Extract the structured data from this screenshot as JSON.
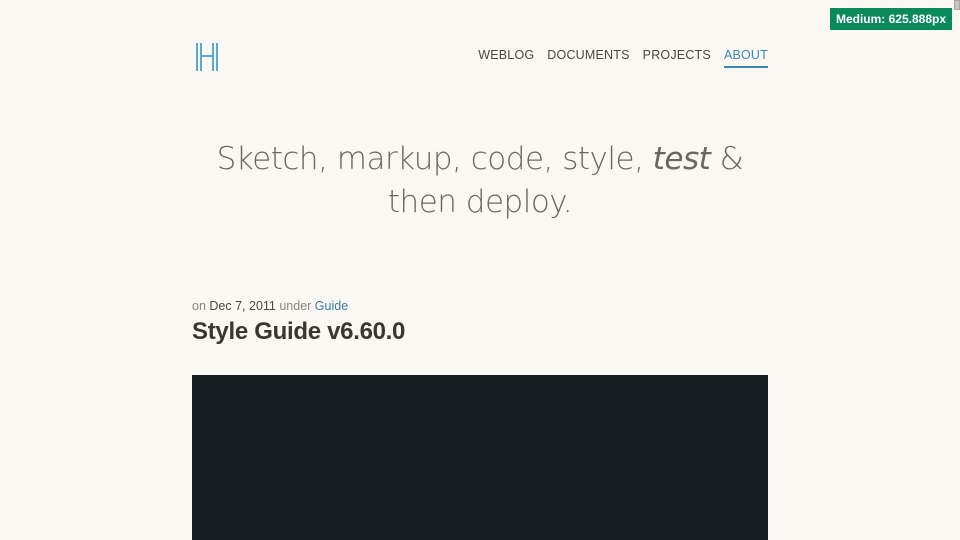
{
  "badge": {
    "text": "Medium: 625.888px"
  },
  "header": {
    "logo_icon": "h-logo-icon",
    "nav": [
      {
        "label": "WEBLOG",
        "active": false
      },
      {
        "label": "DOCUMENTS",
        "active": false
      },
      {
        "label": "PROJECTS",
        "active": false
      },
      {
        "label": "ABOUT",
        "active": true
      }
    ]
  },
  "hero_text": {
    "line1_prefix": "Sketch, markup, code, style, ",
    "line1_italic": "test",
    "line1_suffix": " &",
    "line2": "then deploy."
  },
  "post": {
    "meta_on": "on ",
    "date": "Dec 7, 2011",
    "meta_under": " under ",
    "category": "Guide",
    "title": "Style Guide v6.60.0"
  },
  "colors": {
    "background": "#faf8f2",
    "accent": "#3a89b4",
    "badge": "#0a8a5c",
    "hero_image": "#161c22"
  }
}
